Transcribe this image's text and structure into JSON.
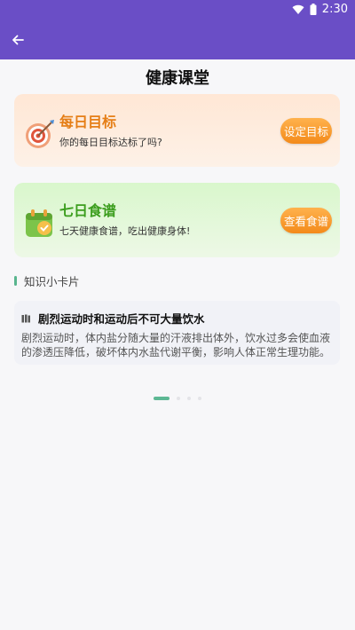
{
  "status_bar": {
    "time": "2:30",
    "wifi_icon": "wifi-icon",
    "battery_icon": "battery-icon"
  },
  "app_bar": {
    "back_icon": "arrow-left-icon",
    "background": "#6a4ec6"
  },
  "page": {
    "title": "健康课堂"
  },
  "goal_card": {
    "icon": "target-dart-icon",
    "title": "每日目标",
    "subtitle": "你的每日目标达标了吗?",
    "button_label": "设定目标",
    "title_color": "#e57e16"
  },
  "diet_card": {
    "icon": "calendar-check-icon",
    "title": "七日食谱",
    "subtitle": "七天健康食谱，吃出健康身体!",
    "button_label": "查看食谱",
    "title_color": "#3c9e1e"
  },
  "knowledge_section": {
    "label": "知识小卡片",
    "accent": "#59b58e"
  },
  "tip_card": {
    "icon": "book-icon",
    "title": "剧烈运动时和运动后不可大量饮水",
    "body": "剧烈运动时，体内盐分随大量的汗液排出体外，饮水过多会使血液的渗透压降低，破坏体内水盐代谢平衡，影响人体正常生理功能。"
  },
  "pager": {
    "total": 4,
    "active_index": 0
  }
}
